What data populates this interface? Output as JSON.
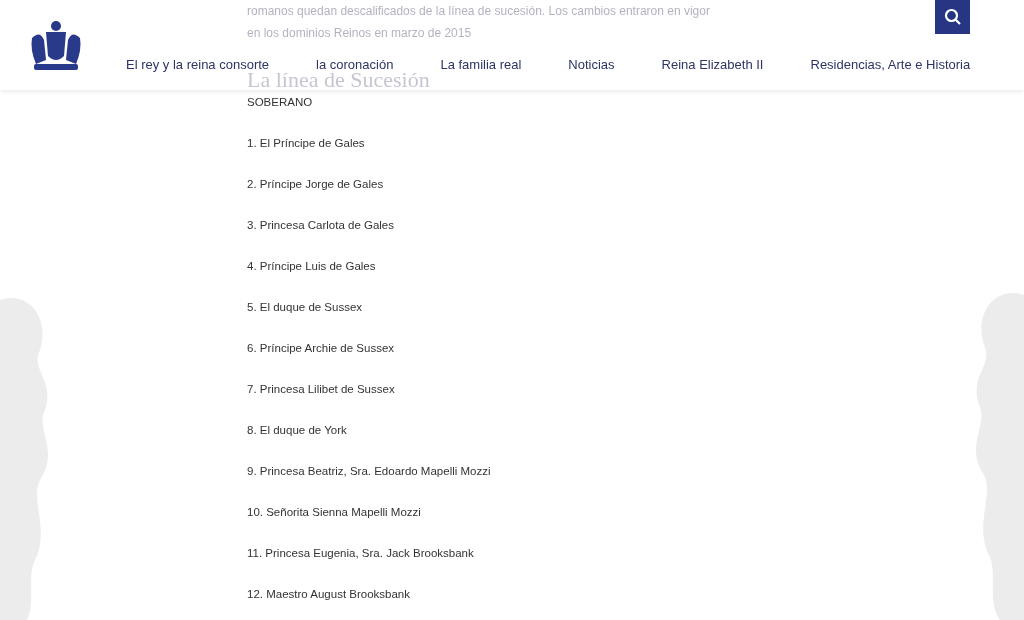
{
  "intro_text": [
    "romanos quedan descalificados de la línea de sucesión. Los cambios entraron en vigor",
    "en los dominios Reinos en marzo de 2015"
  ],
  "heading": "La línea de Sucesión",
  "nav": [
    {
      "label": "El rey y la reina consorte"
    },
    {
      "label": "la coronación"
    },
    {
      "label": "La familia real"
    },
    {
      "label": "Noticias"
    },
    {
      "label": "Reina Elizabeth II"
    },
    {
      "label": "Residencias, Arte e Historia"
    }
  ],
  "succession": [
    "SOBERANO",
    "1. El Príncipe de Gales",
    "2. Príncipe Jorge de Gales",
    "3. Princesa Carlota de Gales",
    "4. Príncipe Luis de Gales",
    "5. El duque de Sussex",
    "6. Príncipe Archie de Sussex",
    "7. Princesa Lilibet de Sussex",
    "8. El duque de York",
    "9. Princesa Beatriz, Sra. Edoardo Mapelli Mozzi",
    "10. Señorita Sienna Mapelli Mozzi",
    "11. Princesa Eugenia, Sra. Jack Brooksbank",
    "12. Maestro August Brooksbank"
  ]
}
